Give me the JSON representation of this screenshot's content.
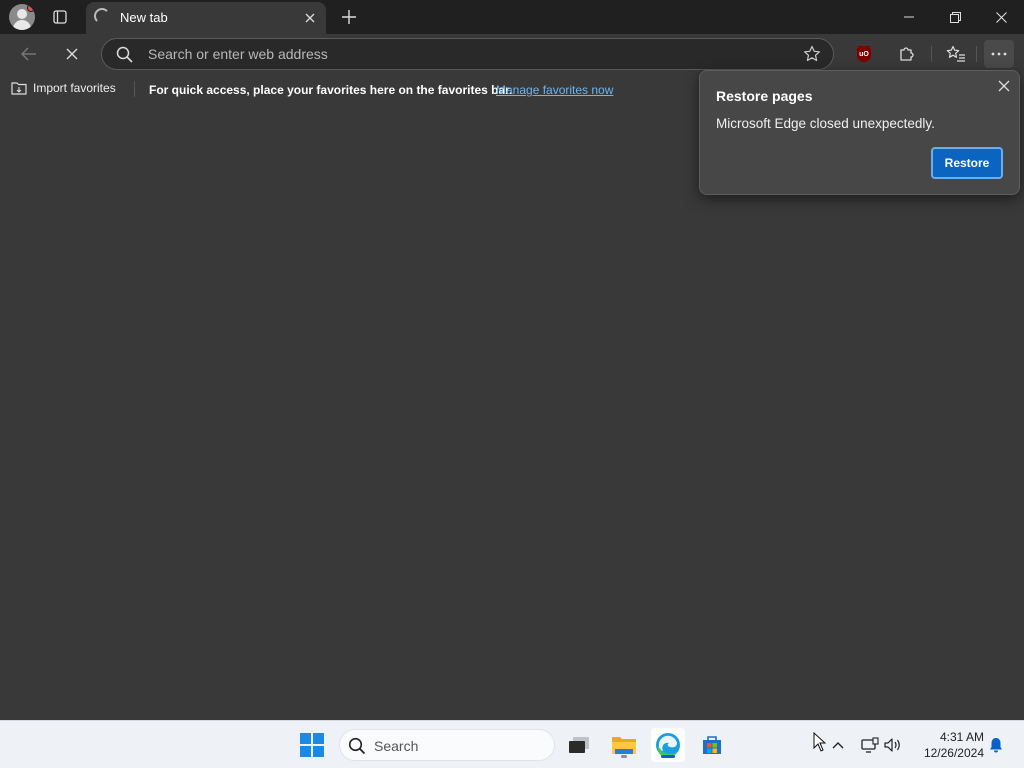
{
  "browser": {
    "tab": {
      "title": "New tab"
    },
    "address_bar": {
      "placeholder": "Search or enter web address",
      "value": ""
    },
    "favorites_bar": {
      "import_label": "Import favorites",
      "message": "For quick access, place your favorites here on the favorites bar.",
      "link": "Manage favorites now"
    },
    "extension": {
      "label": "uO"
    }
  },
  "restore_popup": {
    "title": "Restore pages",
    "message": "Microsoft Edge closed unexpectedly.",
    "button": "Restore"
  },
  "taskbar": {
    "search_label": "Search",
    "time": "4:31 AM",
    "date": "12/26/2024",
    "apps": [
      "task-view",
      "file-explorer",
      "microsoft-edge",
      "microsoft-store"
    ]
  },
  "colors": {
    "accent": "#0b64c0",
    "link": "#6fb4ee",
    "page_bg": "#393939",
    "titlebar_bg": "#202020",
    "taskbar_bg": "#eef1f6"
  }
}
